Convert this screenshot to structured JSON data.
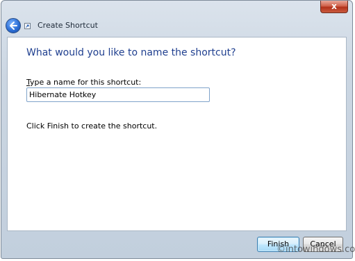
{
  "window": {
    "title": "Create Shortcut",
    "close_label": "x"
  },
  "page": {
    "heading": "What would you like to name the shortcut?",
    "field_label_mnemonic": "T",
    "field_label_rest": "ype a name for this shortcut:",
    "shortcut_name_value": "Hibernate Hotkey",
    "hint": "Click Finish to create the shortcut."
  },
  "buttons": {
    "finish_label": "Finish",
    "cancel_label": "Cancel"
  },
  "watermark": "©intowindows.com",
  "icons": {
    "back": "back-arrow-icon",
    "shortcut": "shortcut-arrow-icon",
    "close": "close-icon"
  },
  "colors": {
    "heading": "#1f3f8f",
    "close_button": "#c0452b",
    "back_button": "#2d6fd6"
  }
}
